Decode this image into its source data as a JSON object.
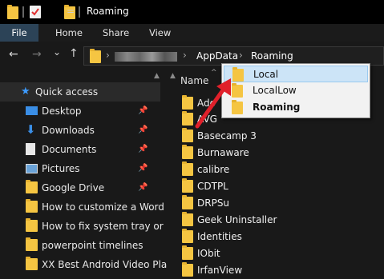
{
  "titlebar": {
    "title": "Roaming",
    "qat_dropdown_glyph": "="
  },
  "ribbon": {
    "tabs": [
      "File",
      "Home",
      "Share",
      "View"
    ]
  },
  "navigation": {
    "back_glyph": "←",
    "forward_glyph": "→",
    "recent_glyph": "⌄",
    "up_glyph": "↑"
  },
  "breadcrumb": {
    "sep_glyph": "›",
    "items": [
      "AppData",
      "Roaming"
    ]
  },
  "column_header": {
    "name": "Name",
    "sort_glyph": "^"
  },
  "sidebar": {
    "quick_access": "Quick access",
    "items": [
      {
        "label": "Desktop",
        "icon": "desktop-icon",
        "pinned": true
      },
      {
        "label": "Downloads",
        "icon": "downloads-icon",
        "pinned": true
      },
      {
        "label": "Documents",
        "icon": "documents-icon",
        "pinned": true
      },
      {
        "label": "Pictures",
        "icon": "pictures-icon",
        "pinned": true
      },
      {
        "label": "Google Drive",
        "icon": "folder-icon",
        "pinned": true
      },
      {
        "label": "How to customize a Word",
        "icon": "folder-icon",
        "pinned": false
      },
      {
        "label": "How to fix system tray or",
        "icon": "folder-icon",
        "pinned": false
      },
      {
        "label": "powerpoint timelines",
        "icon": "folder-icon",
        "pinned": false
      },
      {
        "label": "XX Best Android Video Pla",
        "icon": "folder-icon",
        "pinned": false
      }
    ]
  },
  "files": [
    "Ado",
    "AVG",
    "Basecamp 3",
    "Burnaware",
    "calibre",
    "CDTPL",
    "DRPSu",
    "Geek Uninstaller",
    "Identities",
    "IObit",
    "IrfanView"
  ],
  "dropdown": {
    "items": [
      {
        "label": "Local",
        "selected": true,
        "bold": false
      },
      {
        "label": "LocalLow",
        "selected": false,
        "bold": false
      },
      {
        "label": "Roaming",
        "selected": false,
        "bold": true
      }
    ]
  },
  "colors": {
    "background": "#191919",
    "file_tab": "#2c4357",
    "folder": "#f5c542",
    "arrow": "#e0202a",
    "dropdown_selected": "#cce4f7"
  }
}
